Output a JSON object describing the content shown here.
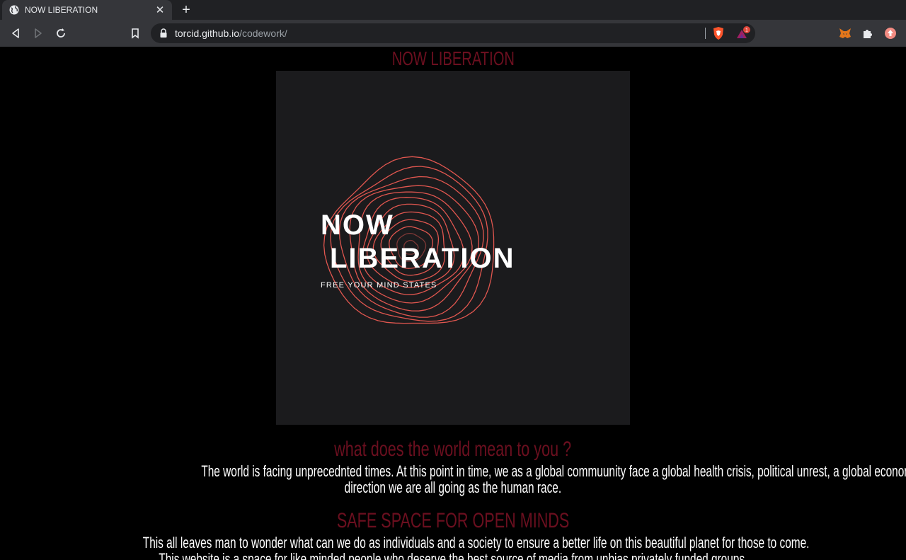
{
  "browser": {
    "tab": {
      "title": "NOW LIBERATION",
      "close": "✕"
    },
    "new_tab": "+",
    "address": {
      "host": "torcid.github.io",
      "path": "/codework/"
    },
    "rewards_badge": "1"
  },
  "page": {
    "heading": "NOW LIBERATION",
    "logo": {
      "line1": "NOW",
      "line2": "LIBERATION",
      "tagline": "FREE YOUR MIND STATES"
    },
    "question": "what does the world mean to you ?",
    "intro_line1": "The world is facing unprecednted times. At this point in time, we as a global commuunity face a global health crisis, political unrest, a global economic crash and last but not least uncertainty in the",
    "intro_line2": "direction we are all going as the human race.",
    "safe_heading": "SAFE SPACE FOR OPEN MINDS",
    "body_line1": "This all leaves man to wonder what can we do as individuals and a society to ensure a better life on this beautiful planet for those to come.",
    "body_line2": "This website is a space for like minded people who deserve the best source of media from unbias privately funded groups."
  },
  "colors": {
    "heading_red": "#6b0f1f",
    "ring_red": "#e0564f",
    "hero_bg": "#1b1b1d",
    "chrome_dark": "#202124",
    "chrome_mid": "#35363a"
  },
  "icons": [
    "globe-icon",
    "close-icon",
    "plus-icon",
    "back-icon",
    "forward-icon",
    "reload-icon",
    "bookmark-icon",
    "lock-icon",
    "brave-shield-icon",
    "brave-rewards-icon",
    "metamask-icon",
    "extensions-icon",
    "profile-icon"
  ]
}
